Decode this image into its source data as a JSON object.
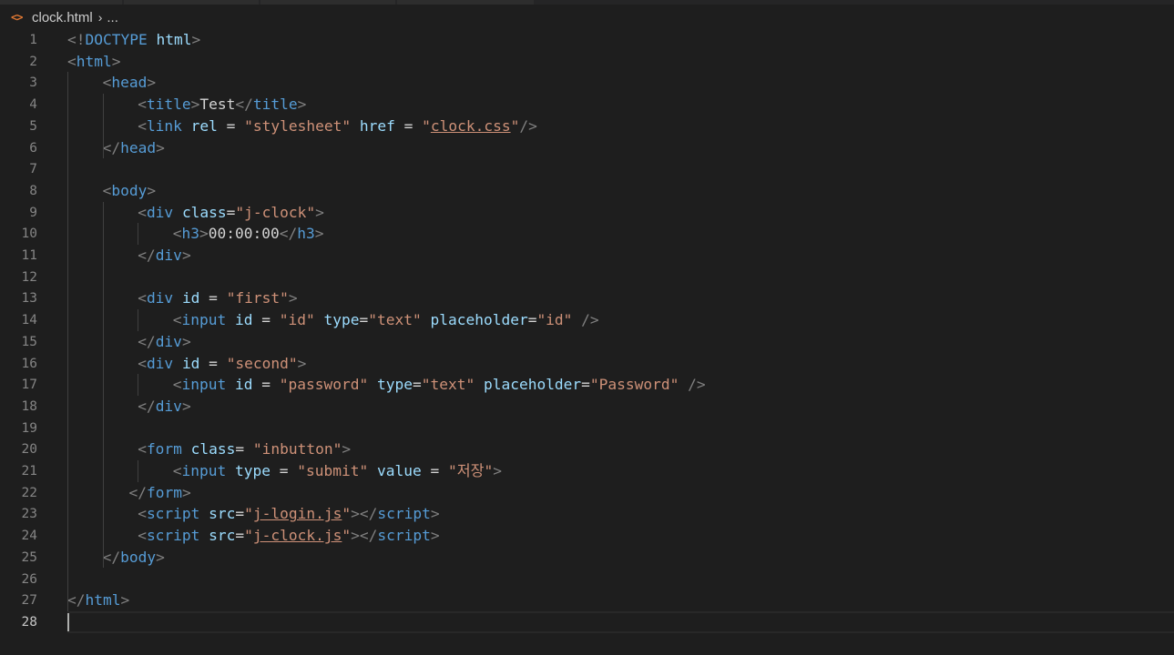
{
  "breadcrumb": {
    "icon": "html-file-icon",
    "file": "clock.html",
    "separator": "›",
    "more": "..."
  },
  "colors": {
    "background": "#1e1e1e",
    "line_number": "#858585",
    "punctuation": "#808080",
    "tag": "#569cd6",
    "attribute": "#9cdcfe",
    "string": "#ce9178",
    "text": "#d4d4d4",
    "file_icon": "#e37933"
  },
  "editor": {
    "cursor_line": 28,
    "lines": [
      {
        "number": "1",
        "indent": 0,
        "tokens": [
          [
            "punc",
            "<!"
          ],
          [
            "tag",
            "DOCTYPE"
          ],
          [
            "text",
            " "
          ],
          [
            "attr",
            "html"
          ],
          [
            "punc",
            ">"
          ]
        ]
      },
      {
        "number": "2",
        "indent": 0,
        "tokens": [
          [
            "punc",
            "<"
          ],
          [
            "tag",
            "html"
          ],
          [
            "punc",
            ">"
          ]
        ]
      },
      {
        "number": "3",
        "indent": 1,
        "tokens": [
          [
            "punc",
            "<"
          ],
          [
            "tag",
            "head"
          ],
          [
            "punc",
            ">"
          ]
        ]
      },
      {
        "number": "4",
        "indent": 2,
        "tokens": [
          [
            "punc",
            "<"
          ],
          [
            "tag",
            "title"
          ],
          [
            "punc",
            ">"
          ],
          [
            "text",
            "Test"
          ],
          [
            "punc",
            "</"
          ],
          [
            "tag",
            "title"
          ],
          [
            "punc",
            ">"
          ]
        ]
      },
      {
        "number": "5",
        "indent": 2,
        "tokens": [
          [
            "punc",
            "<"
          ],
          [
            "tag",
            "link"
          ],
          [
            "text",
            " "
          ],
          [
            "attr",
            "rel"
          ],
          [
            "text",
            " = "
          ],
          [
            "str",
            "\"stylesheet\""
          ],
          [
            "text",
            " "
          ],
          [
            "attr",
            "href"
          ],
          [
            "text",
            " = "
          ],
          [
            "str",
            "\""
          ],
          [
            "link",
            "clock.css"
          ],
          [
            "str",
            "\""
          ],
          [
            "punc",
            "/>"
          ]
        ]
      },
      {
        "number": "6",
        "indent": 1,
        "tokens": [
          [
            "punc",
            "</"
          ],
          [
            "tag",
            "head"
          ],
          [
            "punc",
            ">"
          ]
        ]
      },
      {
        "number": "7",
        "indent": 0,
        "tokens": []
      },
      {
        "number": "8",
        "indent": 1,
        "tokens": [
          [
            "punc",
            "<"
          ],
          [
            "tag",
            "body"
          ],
          [
            "punc",
            ">"
          ]
        ]
      },
      {
        "number": "9",
        "indent": 2,
        "tokens": [
          [
            "punc",
            "<"
          ],
          [
            "tag",
            "div"
          ],
          [
            "text",
            " "
          ],
          [
            "attr",
            "class"
          ],
          [
            "text",
            "="
          ],
          [
            "str",
            "\"j-clock\""
          ],
          [
            "punc",
            ">"
          ]
        ]
      },
      {
        "number": "10",
        "indent": 3,
        "tokens": [
          [
            "punc",
            "<"
          ],
          [
            "tag",
            "h3"
          ],
          [
            "punc",
            ">"
          ],
          [
            "text",
            "00:00:00"
          ],
          [
            "punc",
            "</"
          ],
          [
            "tag",
            "h3"
          ],
          [
            "punc",
            ">"
          ]
        ]
      },
      {
        "number": "11",
        "indent": 2,
        "tokens": [
          [
            "punc",
            "</"
          ],
          [
            "tag",
            "div"
          ],
          [
            "punc",
            ">"
          ]
        ]
      },
      {
        "number": "12",
        "indent": 0,
        "tokens": []
      },
      {
        "number": "13",
        "indent": 2,
        "tokens": [
          [
            "punc",
            "<"
          ],
          [
            "tag",
            "div"
          ],
          [
            "text",
            " "
          ],
          [
            "attr",
            "id"
          ],
          [
            "text",
            " = "
          ],
          [
            "str",
            "\"first\""
          ],
          [
            "punc",
            ">"
          ]
        ]
      },
      {
        "number": "14",
        "indent": 3,
        "tokens": [
          [
            "punc",
            "<"
          ],
          [
            "tag",
            "input"
          ],
          [
            "text",
            " "
          ],
          [
            "attr",
            "id"
          ],
          [
            "text",
            " = "
          ],
          [
            "str",
            "\"id\""
          ],
          [
            "text",
            " "
          ],
          [
            "attr",
            "type"
          ],
          [
            "text",
            "="
          ],
          [
            "str",
            "\"text\""
          ],
          [
            "text",
            " "
          ],
          [
            "attr",
            "placeholder"
          ],
          [
            "text",
            "="
          ],
          [
            "str",
            "\"id\""
          ],
          [
            "text",
            " "
          ],
          [
            "punc",
            "/>"
          ]
        ]
      },
      {
        "number": "15",
        "indent": 2,
        "tokens": [
          [
            "punc",
            "</"
          ],
          [
            "tag",
            "div"
          ],
          [
            "punc",
            ">"
          ]
        ]
      },
      {
        "number": "16",
        "indent": 2,
        "tokens": [
          [
            "punc",
            "<"
          ],
          [
            "tag",
            "div"
          ],
          [
            "text",
            " "
          ],
          [
            "attr",
            "id"
          ],
          [
            "text",
            " = "
          ],
          [
            "str",
            "\"second\""
          ],
          [
            "punc",
            ">"
          ]
        ]
      },
      {
        "number": "17",
        "indent": 3,
        "tokens": [
          [
            "punc",
            "<"
          ],
          [
            "tag",
            "input"
          ],
          [
            "text",
            " "
          ],
          [
            "attr",
            "id"
          ],
          [
            "text",
            " = "
          ],
          [
            "str",
            "\"password\""
          ],
          [
            "text",
            " "
          ],
          [
            "attr",
            "type"
          ],
          [
            "text",
            "="
          ],
          [
            "str",
            "\"text\""
          ],
          [
            "text",
            " "
          ],
          [
            "attr",
            "placeholder"
          ],
          [
            "text",
            "="
          ],
          [
            "str",
            "\"Password\""
          ],
          [
            "text",
            " "
          ],
          [
            "punc",
            "/>"
          ]
        ]
      },
      {
        "number": "18",
        "indent": 2,
        "tokens": [
          [
            "punc",
            "</"
          ],
          [
            "tag",
            "div"
          ],
          [
            "punc",
            ">"
          ]
        ]
      },
      {
        "number": "19",
        "indent": 0,
        "tokens": []
      },
      {
        "number": "20",
        "indent": 2,
        "tokens": [
          [
            "punc",
            "<"
          ],
          [
            "tag",
            "form"
          ],
          [
            "text",
            " "
          ],
          [
            "attr",
            "class"
          ],
          [
            "text",
            "= "
          ],
          [
            "str",
            "\"inbutton\""
          ],
          [
            "punc",
            ">"
          ]
        ]
      },
      {
        "number": "21",
        "indent": 3,
        "tokens": [
          [
            "punc",
            "<"
          ],
          [
            "tag",
            "input"
          ],
          [
            "text",
            " "
          ],
          [
            "attr",
            "type"
          ],
          [
            "text",
            " = "
          ],
          [
            "str",
            "\"submit\""
          ],
          [
            "text",
            " "
          ],
          [
            "attr",
            "value"
          ],
          [
            "text",
            " = "
          ],
          [
            "str",
            "\"저장\""
          ],
          [
            "punc",
            ">"
          ]
        ]
      },
      {
        "number": "22",
        "indent": 1.75,
        "tokens": [
          [
            "punc",
            "</"
          ],
          [
            "tag",
            "form"
          ],
          [
            "punc",
            ">"
          ]
        ]
      },
      {
        "number": "23",
        "indent": 2,
        "tokens": [
          [
            "punc",
            "<"
          ],
          [
            "tag",
            "script"
          ],
          [
            "text",
            " "
          ],
          [
            "attr",
            "src"
          ],
          [
            "text",
            "="
          ],
          [
            "str",
            "\""
          ],
          [
            "link",
            "j-login.js"
          ],
          [
            "str",
            "\""
          ],
          [
            "punc",
            "></"
          ],
          [
            "tag",
            "script"
          ],
          [
            "punc",
            ">"
          ]
        ]
      },
      {
        "number": "24",
        "indent": 2,
        "tokens": [
          [
            "punc",
            "<"
          ],
          [
            "tag",
            "script"
          ],
          [
            "text",
            " "
          ],
          [
            "attr",
            "src"
          ],
          [
            "text",
            "="
          ],
          [
            "str",
            "\""
          ],
          [
            "link",
            "j-clock.js"
          ],
          [
            "str",
            "\""
          ],
          [
            "punc",
            "></"
          ],
          [
            "tag",
            "script"
          ],
          [
            "punc",
            ">"
          ]
        ]
      },
      {
        "number": "25",
        "indent": 1,
        "tokens": [
          [
            "punc",
            "</"
          ],
          [
            "tag",
            "body"
          ],
          [
            "punc",
            ">"
          ]
        ]
      },
      {
        "number": "26",
        "indent": 0,
        "tokens": []
      },
      {
        "number": "27",
        "indent": 0,
        "tokens": [
          [
            "punc",
            "</"
          ],
          [
            "tag",
            "html"
          ],
          [
            "punc",
            ">"
          ]
        ]
      },
      {
        "number": "28",
        "indent": 0,
        "tokens": []
      }
    ]
  }
}
